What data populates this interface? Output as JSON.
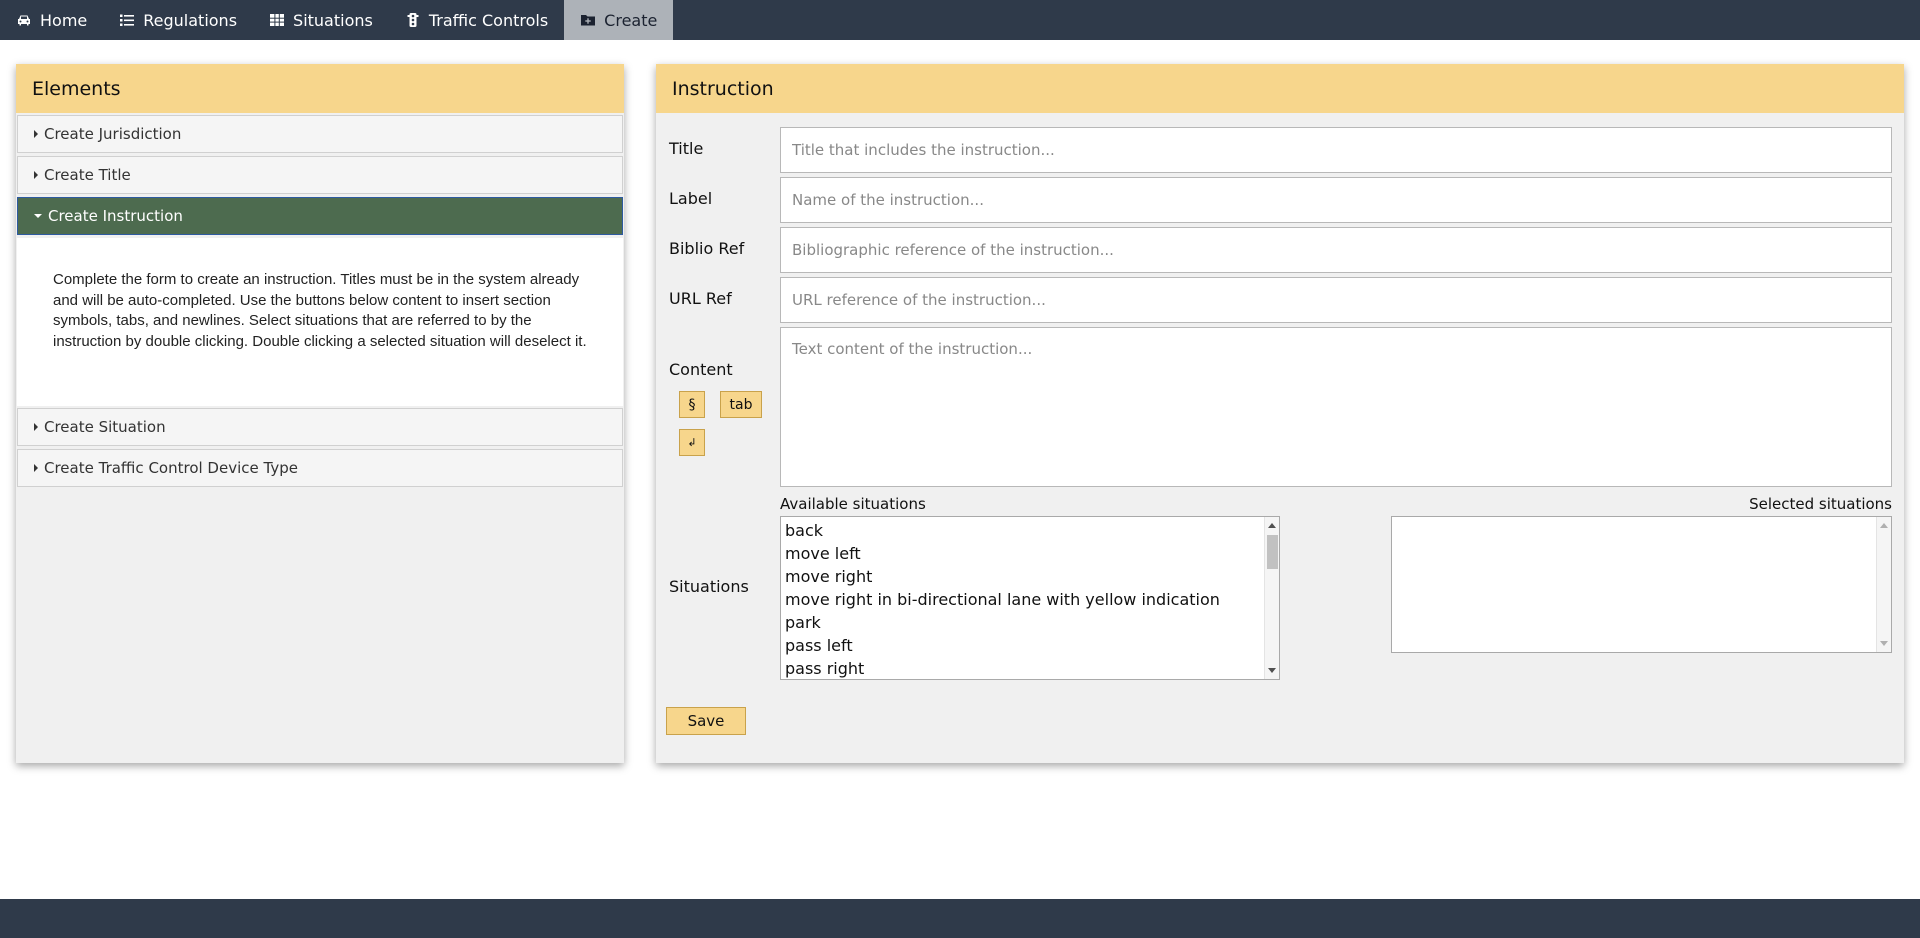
{
  "nav": {
    "items": [
      {
        "label": "Home",
        "icon": "car-icon"
      },
      {
        "label": "Regulations",
        "icon": "list-icon"
      },
      {
        "label": "Situations",
        "icon": "table-icon"
      },
      {
        "label": "Traffic Controls",
        "icon": "traffic-light-icon"
      },
      {
        "label": "Create",
        "icon": "folder-plus-icon",
        "active": true
      }
    ]
  },
  "left": {
    "title": "Elements",
    "items": [
      {
        "label": "Create Jurisdiction"
      },
      {
        "label": "Create Title"
      },
      {
        "label": "Create Instruction",
        "open": true
      },
      {
        "label": "Create Situation"
      },
      {
        "label": "Create Traffic Control Device Type"
      }
    ],
    "open_text": "Complete the form to create an instruction. Titles must be in the system already and will be auto-completed. Use the buttons below content to insert section symbols, tabs, and newlines. Select situations that are referred to by the instruction by double clicking. Double clicking a selected situation will deselect it."
  },
  "right": {
    "title": "Instruction",
    "fields": {
      "title": {
        "label": "Title",
        "placeholder": "Title that includes the instruction..."
      },
      "label": {
        "label": "Label",
        "placeholder": "Name of the instruction..."
      },
      "biblio": {
        "label": "Biblio Ref",
        "placeholder": "Bibliographic reference of the instruction..."
      },
      "url": {
        "label": "URL Ref",
        "placeholder": "URL reference of the instruction..."
      },
      "content": {
        "label": "Content",
        "placeholder": "Text content of the instruction..."
      }
    },
    "insert_buttons": {
      "section": "§",
      "tab": "tab",
      "newline": "↲"
    },
    "situations": {
      "label": "Situations",
      "available_label": "Available situations",
      "selected_label": "Selected situations",
      "available": [
        "back",
        "move left",
        "move right",
        "move right in bi-directional lane with yellow indication",
        "park",
        "pass left",
        "pass right"
      ],
      "selected": []
    },
    "save_label": "Save"
  },
  "colors": {
    "nav_bg": "#2f3a4a",
    "accent": "#f7d68c",
    "open_item": "#4d6b4f",
    "panel_bg": "#f0f0f0"
  }
}
